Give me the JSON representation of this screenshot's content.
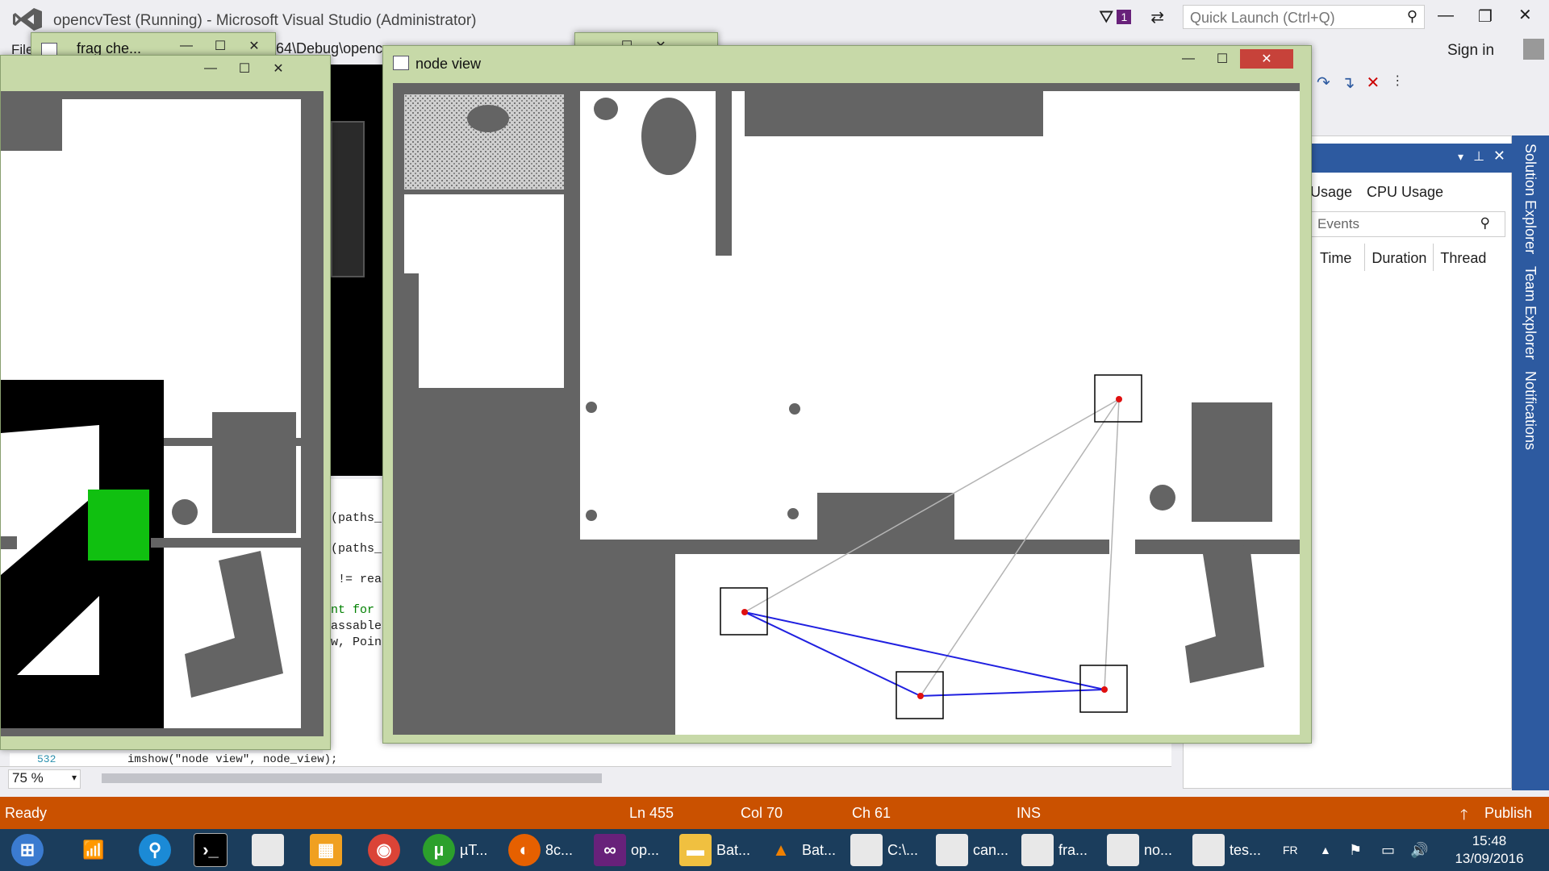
{
  "vs": {
    "title": "opencvTest (Running) - Microsoft Visual Studio (Administrator)",
    "notif_count": "1",
    "quick_launch_placeholder": "Quick Launch (Ctrl+Q)",
    "sign_in": "Sign in",
    "menu_partial": "File",
    "path_partial": "64\\Debug\\openc",
    "status": {
      "ready": "Ready",
      "ln": "Ln 455",
      "col": "Col 70",
      "ch": "Ch 61",
      "ins": "INS",
      "publish": "Publish"
    },
    "zoom": "75 %",
    "diag": {
      "tabs": [
        "Usage",
        "CPU Usage"
      ],
      "events_placeholder": "Events",
      "columns": [
        "Time",
        "Duration",
        "Thread"
      ]
    },
    "side_tabs": [
      "Solution Explorer",
      "Team Explorer",
      "Notifications"
    ],
    "code_lines": [
      {
        "text": "(paths_t"
      },
      {
        "text": "(paths_t"
      },
      {
        "text": " != reac"
      },
      {
        "text": "nt for p",
        "color": "#008000"
      },
      {
        "text": "assable "
      },
      {
        "text": "w, Point",
        "color": "#2b91af"
      }
    ],
    "line_number": "532",
    "imshow_line": "imshow(\"node view\", node_view);"
  },
  "windows": {
    "frag": {
      "title": "frag che..."
    },
    "back": {
      "title": ""
    },
    "node_view": {
      "title": "node view"
    }
  },
  "taskbar": {
    "items": [
      "µT...",
      "8c...",
      "op...",
      "Bat...",
      "Bat...",
      "C:\\...",
      "can...",
      "fra...",
      "no...",
      "tes..."
    ],
    "lang": "FR",
    "time": "15:48",
    "date": "13/09/2016"
  },
  "colors": {
    "vs_accent": "#ca5100",
    "panel_blue": "#2d5aa0",
    "obstacle": "#646464",
    "path_blue": "#2020e0",
    "node_red": "#e01010",
    "frag_green": "#10c010"
  }
}
